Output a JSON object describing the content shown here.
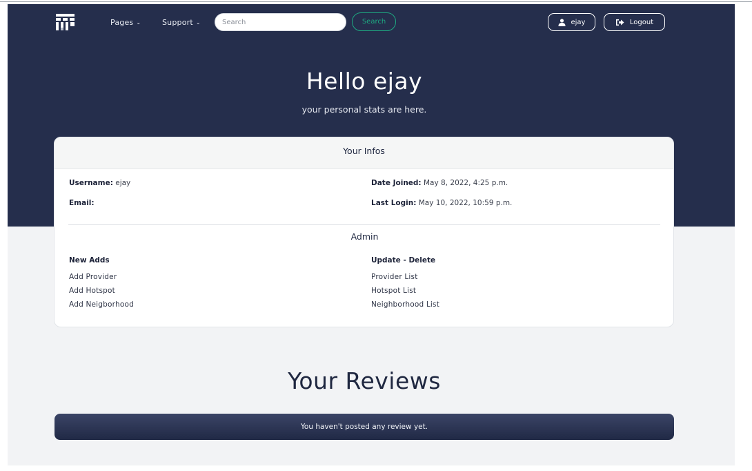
{
  "navbar": {
    "logo_icon": "grid-logo-icon",
    "pages_label": "Pages",
    "support_label": "Support",
    "search": {
      "placeholder": "Search",
      "value": ""
    },
    "search_button_label": "Search",
    "user_button_label": "ejay",
    "logout_button_label": "Logout"
  },
  "hero": {
    "greeting": "Hello ejay",
    "subtitle": "your personal stats are here."
  },
  "info_card": {
    "title": "Your Infos",
    "username_label": "Username:",
    "username_value": "ejay",
    "email_label": "Email:",
    "email_value": "",
    "date_joined_label": "Date Joined:",
    "date_joined_value": "May 8, 2022, 4:25 p.m.",
    "last_login_label": "Last Login:",
    "last_login_value": "May 10, 2022, 10:59 p.m."
  },
  "admin": {
    "title": "Admin",
    "new_adds_heading": "New Adds",
    "new_adds": [
      "Add Provider",
      "Add Hotspot",
      "Add Neigborhood"
    ],
    "update_delete_heading": "Update - Delete",
    "update_delete": [
      "Provider List",
      "Hotspot List",
      "Neighborhood List"
    ]
  },
  "reviews": {
    "title": "Your Reviews",
    "empty_message": "You haven't posted any review yet."
  },
  "colors": {
    "hero_bg": "#252e4c",
    "accent_green": "#1ea981",
    "page_bg": "#f2f3f5"
  }
}
